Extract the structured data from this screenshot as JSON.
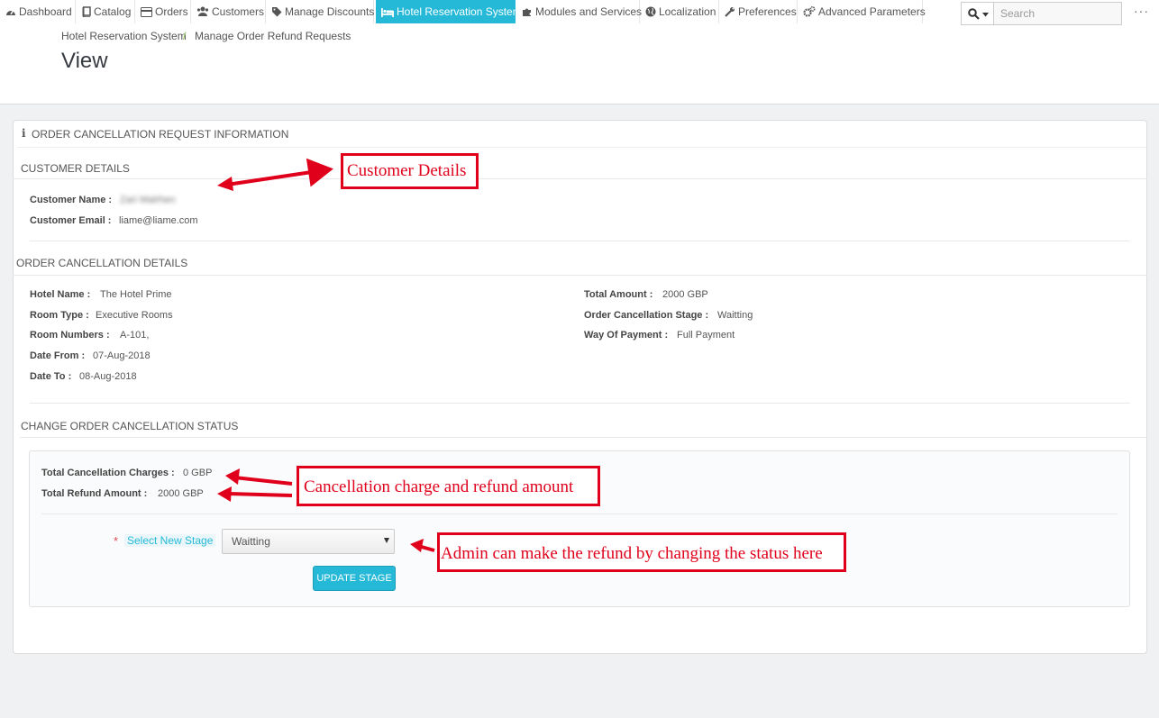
{
  "nav": {
    "items": [
      {
        "label": "Dashboard",
        "icon": "dashboard-icon"
      },
      {
        "label": "Catalog",
        "icon": "book-icon"
      },
      {
        "label": "Orders",
        "icon": "credit-card-icon"
      },
      {
        "label": "Customers",
        "icon": "users-icon"
      },
      {
        "label": "Manage Discounts",
        "icon": "tag-icon"
      },
      {
        "label": "Hotel Reservation System",
        "icon": "bed-icon",
        "active": true
      },
      {
        "label": "Modules and Services",
        "icon": "puzzle-icon"
      },
      {
        "label": "Localization",
        "icon": "globe-icon"
      },
      {
        "label": "Preferences",
        "icon": "wrench-icon"
      },
      {
        "label": "Advanced Parameters",
        "icon": "cogs-icon"
      }
    ],
    "search_placeholder": "Search",
    "accent": "#25b9d7"
  },
  "breadcrumb": {
    "item1": "Hotel Reservation System",
    "separator": "/",
    "item2": "Manage Order Refund Requests"
  },
  "page_title": "View",
  "panel": {
    "heading": "ORDER CANCELLATION REQUEST INFORMATION",
    "customer": {
      "title": "CUSTOMER DETAILS",
      "name_label": "Customer Name :",
      "name_value": "Zari Malrhen",
      "email_label": "Customer Email :",
      "email_value": "liame@liame.com"
    },
    "order": {
      "title": "ORDER CANCELLATION DETAILS",
      "hotel_label": "Hotel Name :",
      "hotel_value": "The Hotel Prime",
      "room_type_label": "Room Type :",
      "room_type_value": "Executive Rooms",
      "room_numbers_label": "Room Numbers :",
      "room_numbers_value": "A-101,",
      "date_from_label": "Date From :",
      "date_from_value": "07-Aug-2018",
      "date_to_label": "Date To :",
      "date_to_value": "08-Aug-2018",
      "total_label": "Total Amount :",
      "total_value": "2000 GBP",
      "stage_label": "Order Cancellation Stage :",
      "stage_value": "Waitting",
      "payment_label": "Way Of Payment :",
      "payment_value": "Full Payment"
    },
    "status": {
      "title": "CHANGE ORDER CANCELLATION STATUS",
      "charges_label": "Total Cancellation Charges :",
      "charges_value": "0 GBP",
      "refund_label": "Total Refund Amount :",
      "refund_value": "2000 GBP",
      "required_mark": "*",
      "select_label": "Select New Stage",
      "select_value": "Waitting",
      "update_button": "UPDATE STAGE"
    }
  },
  "annotations": {
    "customer": "Customer Details",
    "charges": "Cancellation charge and refund amount",
    "admin": "Admin can make the refund by changing the status here",
    "color": "#e0001b"
  }
}
